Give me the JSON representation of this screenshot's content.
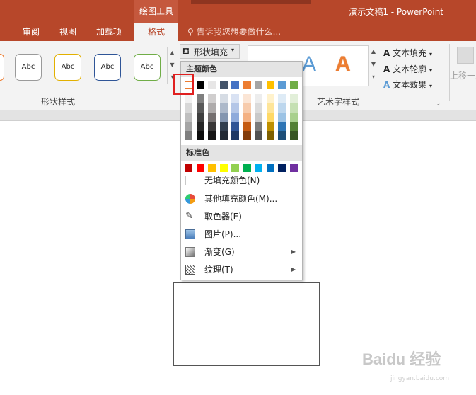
{
  "titlebar": {
    "doc_title": "演示文稿1 - PowerPoint",
    "context_group": "绘图工具"
  },
  "tabs": [
    "审阅",
    "视图",
    "加载项"
  ],
  "active_tab": "格式",
  "tell_me": "告诉我您想要做什么...",
  "ribbon": {
    "shape_style_swatches": [
      "Abc",
      "Abc",
      "Abc",
      "Abc"
    ],
    "shape_styles_label": "形状样式",
    "shape_fill_button": "形状填充",
    "wordart_label": "艺术字样式",
    "text_fill": "文本填充",
    "text_outline": "文本轮廓",
    "text_effects": "文本效果",
    "bring_forward": "上移一层"
  },
  "menu": {
    "theme_colors_header": "主题颜色",
    "standard_colors_header": "标准色",
    "theme_top_row": [
      "#ffffff",
      "#000000",
      "#e7e6e6",
      "#44546a",
      "#4472c4",
      "#ed7d31",
      "#a5a5a5",
      "#ffc000",
      "#5b9bd5",
      "#70ad47"
    ],
    "theme_shades": [
      [
        "#f2f2f2",
        "#7f7f7f",
        "#d0cece",
        "#d6dce4",
        "#d9e2f3",
        "#fbe5d5",
        "#ededed",
        "#fff2cc",
        "#deebf6",
        "#e2efd9"
      ],
      [
        "#d8d8d8",
        "#595959",
        "#aeabab",
        "#adb9ca",
        "#b4c6e7",
        "#f7cbac",
        "#dbdbdb",
        "#fee599",
        "#bdd7ee",
        "#c5e0b3"
      ],
      [
        "#bfbfbf",
        "#3f3f3f",
        "#757070",
        "#8496b0",
        "#8eaadb",
        "#f4b183",
        "#c9c9c9",
        "#ffd966",
        "#9cc3e5",
        "#a8d08d"
      ],
      [
        "#a5a5a5",
        "#262626",
        "#3a3838",
        "#323f4f",
        "#2f5496",
        "#c55a11",
        "#7b7b7b",
        "#bf9000",
        "#2e75b5",
        "#538135"
      ],
      [
        "#7f7f7f",
        "#0c0c0c",
        "#171616",
        "#222a35",
        "#1f3864",
        "#833c0b",
        "#525252",
        "#7f6000",
        "#1e4e79",
        "#375623"
      ]
    ],
    "standard_colors": [
      "#c00000",
      "#ff0000",
      "#ffc000",
      "#ffff00",
      "#92d050",
      "#00b050",
      "#00b0f0",
      "#0070c0",
      "#002060",
      "#7030a0"
    ],
    "items": {
      "no_fill": "无填充颜色(N)",
      "more_colors": "其他填充颜色(M)...",
      "eyedropper": "取色器(E)",
      "picture": "图片(P)...",
      "gradient": "渐变(G)",
      "texture": "纹理(T)"
    }
  },
  "watermark": "Baidu 经验",
  "watermark_sub": "jingyan.baidu.com"
}
